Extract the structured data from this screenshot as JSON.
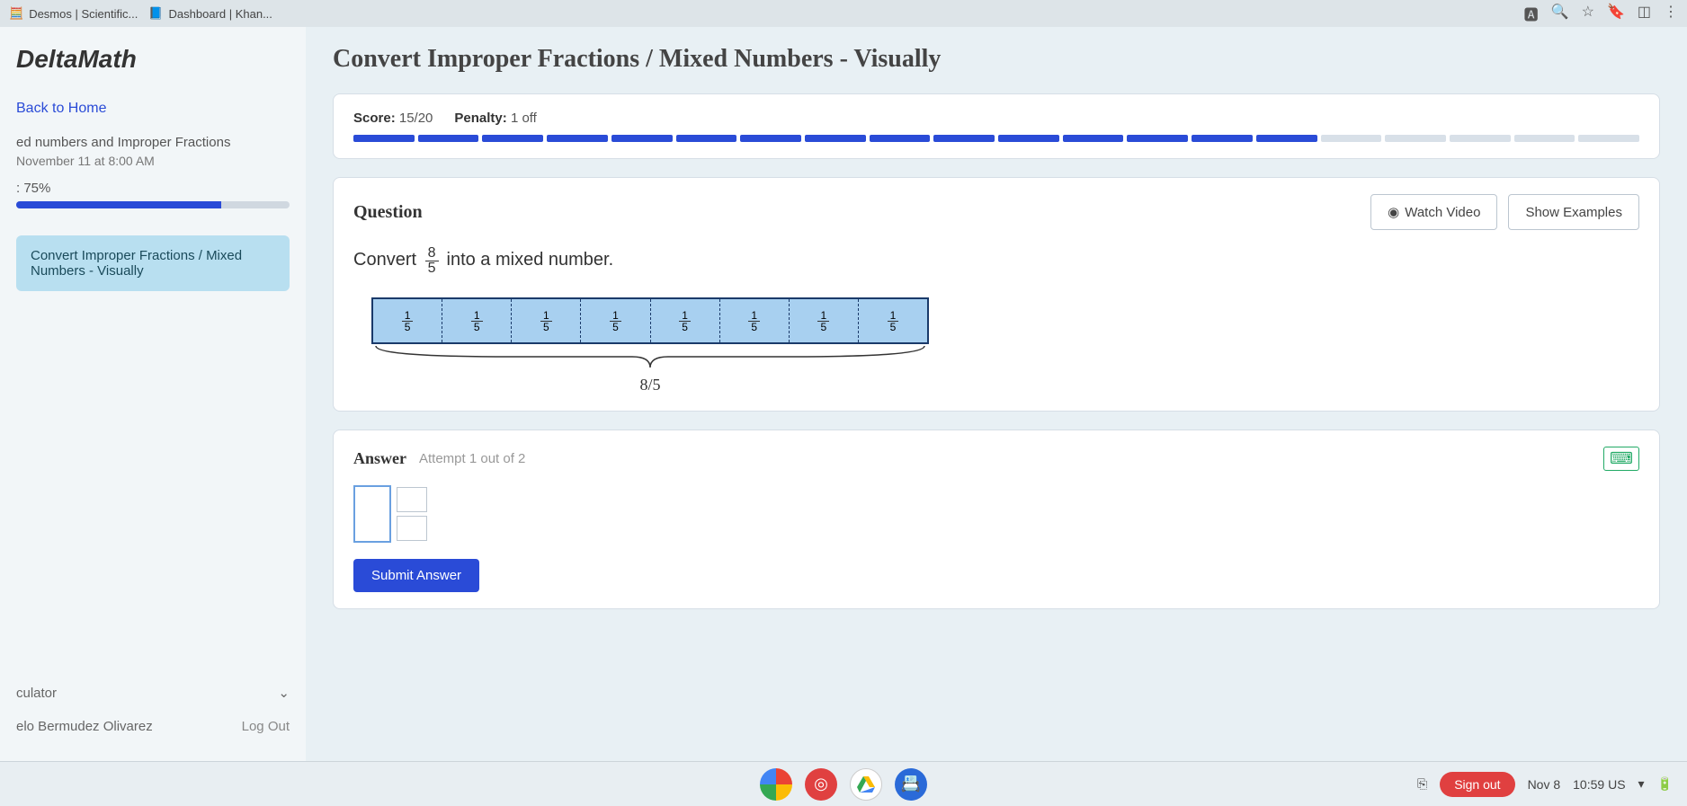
{
  "browser": {
    "tabs": [
      "Desmos | Scientific...",
      "Dashboard | Khan..."
    ],
    "icons": [
      "translate-icon",
      "search-icon",
      "star-icon",
      "bookmark-icon",
      "extension-icon",
      "menu-icon"
    ]
  },
  "sidebar": {
    "logo": "DeltaMath",
    "back": "Back to Home",
    "assignment_title": "ed numbers and Improper Fractions",
    "assignment_due": "November 11 at 8:00 AM",
    "assignment_pct": ": 75%",
    "skill": "Convert Improper Fractions / Mixed Numbers - Visually",
    "calculator": "culator",
    "user": "elo Bermudez Olivarez",
    "logout": "Log Out"
  },
  "page": {
    "title": "Convert Improper Fractions / Mixed Numbers - Visually"
  },
  "scorebar": {
    "score_label": "Score:",
    "score_value": "15/20",
    "penalty_label": "Penalty:",
    "penalty_value": "1 off",
    "segments_total": 20,
    "segments_done": 15
  },
  "question": {
    "heading": "Question",
    "watch": "Watch Video",
    "examples": "Show Examples",
    "prompt_before": "Convert ",
    "prompt_num": "8",
    "prompt_den": "5",
    "prompt_after": " into a mixed number.",
    "bar_segments": 8,
    "seg_num": "1",
    "seg_den": "5",
    "total_label": "8/5"
  },
  "answer": {
    "heading": "Answer",
    "attempt": "Attempt 1 out of 2",
    "submit": "Submit Answer"
  },
  "taskbar": {
    "signout": "Sign out",
    "date": "Nov 8",
    "time": "10:59",
    "locale": "US"
  }
}
